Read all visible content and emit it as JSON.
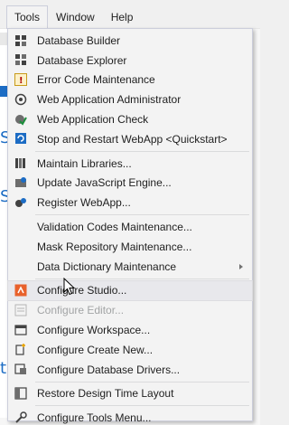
{
  "menubar": {
    "items": [
      {
        "label": "Tools"
      },
      {
        "label": "Window"
      },
      {
        "label": "Help"
      }
    ]
  },
  "tools_menu": {
    "groups": [
      [
        {
          "label": "Database Builder",
          "icon": "database-builder-icon",
          "disabled": false
        },
        {
          "label": "Database Explorer",
          "icon": "database-explorer-icon",
          "disabled": false
        },
        {
          "label": "Error Code Maintenance",
          "icon": "error-code-icon",
          "disabled": false
        },
        {
          "label": "Web Application Administrator",
          "icon": "web-app-admin-icon",
          "disabled": false
        },
        {
          "label": "Web Application Check",
          "icon": "web-app-check-icon",
          "disabled": false
        },
        {
          "label": "Stop and Restart WebApp <Quickstart>",
          "icon": "restart-icon",
          "disabled": false
        }
      ],
      [
        {
          "label": "Maintain Libraries...",
          "icon": "libraries-icon",
          "disabled": false
        },
        {
          "label": "Update JavaScript Engine...",
          "icon": "update-js-icon",
          "disabled": false
        },
        {
          "label": "Register WebApp...",
          "icon": "register-webapp-icon",
          "disabled": false
        }
      ],
      [
        {
          "label": "Validation Codes Maintenance...",
          "icon": "",
          "disabled": false
        },
        {
          "label": "Mask Repository Maintenance...",
          "icon": "",
          "disabled": false
        },
        {
          "label": "Data Dictionary Maintenance",
          "icon": "",
          "disabled": false,
          "submenu": true
        }
      ],
      [
        {
          "label": "Configure Studio...",
          "icon": "configure-studio-icon",
          "disabled": false,
          "hover": true
        },
        {
          "label": "Configure Editor...",
          "icon": "configure-editor-icon",
          "disabled": true
        },
        {
          "label": "Configure Workspace...",
          "icon": "configure-workspace-icon",
          "disabled": false
        },
        {
          "label": "Configure Create New...",
          "icon": "configure-create-new-icon",
          "disabled": false
        },
        {
          "label": "Configure Database Drivers...",
          "icon": "configure-db-drivers-icon",
          "disabled": false
        }
      ],
      [
        {
          "label": "Restore Design Time Layout",
          "icon": "restore-layout-icon",
          "disabled": false
        }
      ],
      [
        {
          "label": "Configure Tools Menu...",
          "icon": "configure-tools-menu-icon",
          "disabled": false
        }
      ]
    ]
  },
  "colors": {
    "menu_bg": "#f3f3f3",
    "menu_border": "#cccedb",
    "hover_bg": "#e8e8ec",
    "disabled_text": "#a2a4a5",
    "accent_blue": "#1c6cc4",
    "accent_orange": "#e8612c"
  }
}
